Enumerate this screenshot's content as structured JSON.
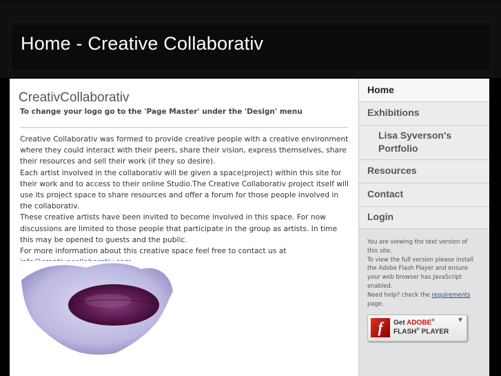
{
  "header": {
    "title": "Home - Creative Collaborativ"
  },
  "logo": {
    "title": "CreativCollaborativ",
    "hint": "To change your logo go to the 'Page Master' under the 'Design' menu"
  },
  "content": {
    "paragraphs": [
      "Creative Collaborativ was formed to provide creative people with a creative environment where they could interact with their peers, share their vision, express themselves, share their resources and sell their work (if they so desire).",
      "Each artist involved in the collaborativ will be given a space(project) within this site for their work and to access to their online Studio.The Creative Collaborativ project itself will use its project space to share resources and offer a forum for those people involved in the collaborativ.",
      "These creative artists have been invited to become involved in this space. For now discussions are limited to those people that participate in the group as artists. In time this may be opened to guests and the public.",
      "For more information about this creative space feel free to contact us at"
    ],
    "email_link": "info@creativecollaborativ.com"
  },
  "nav": {
    "items": [
      {
        "label": "Home"
      },
      {
        "label": "Exhibitions"
      },
      {
        "label": "Lisa Syverson's Portfolio"
      },
      {
        "label": "Resources"
      },
      {
        "label": "Contact"
      },
      {
        "label": "Login"
      }
    ]
  },
  "flash_notice": {
    "line1": "You are viewing the text version of this site.",
    "line2": "To view the full version please install the Adobe Flash Player and ensure your web browser has JavaScript enabled.",
    "line3_pre": "Need help? check the",
    "line3_link": "requirements",
    "line3_post": "page."
  },
  "flash_badge": {
    "get": "Get",
    "brand": "ADOBE",
    "registered": "®",
    "product": "FLASH",
    "product_registered": "®",
    "product_suffix": "PLAYER",
    "logo_letter": "f"
  },
  "colors": {
    "background": "#000000",
    "sidebar": "#e2e2e2",
    "link": "#2a4a8a",
    "artwork_leaf": "#c9c6e6",
    "artwork_oval": "#5a1a4e"
  }
}
